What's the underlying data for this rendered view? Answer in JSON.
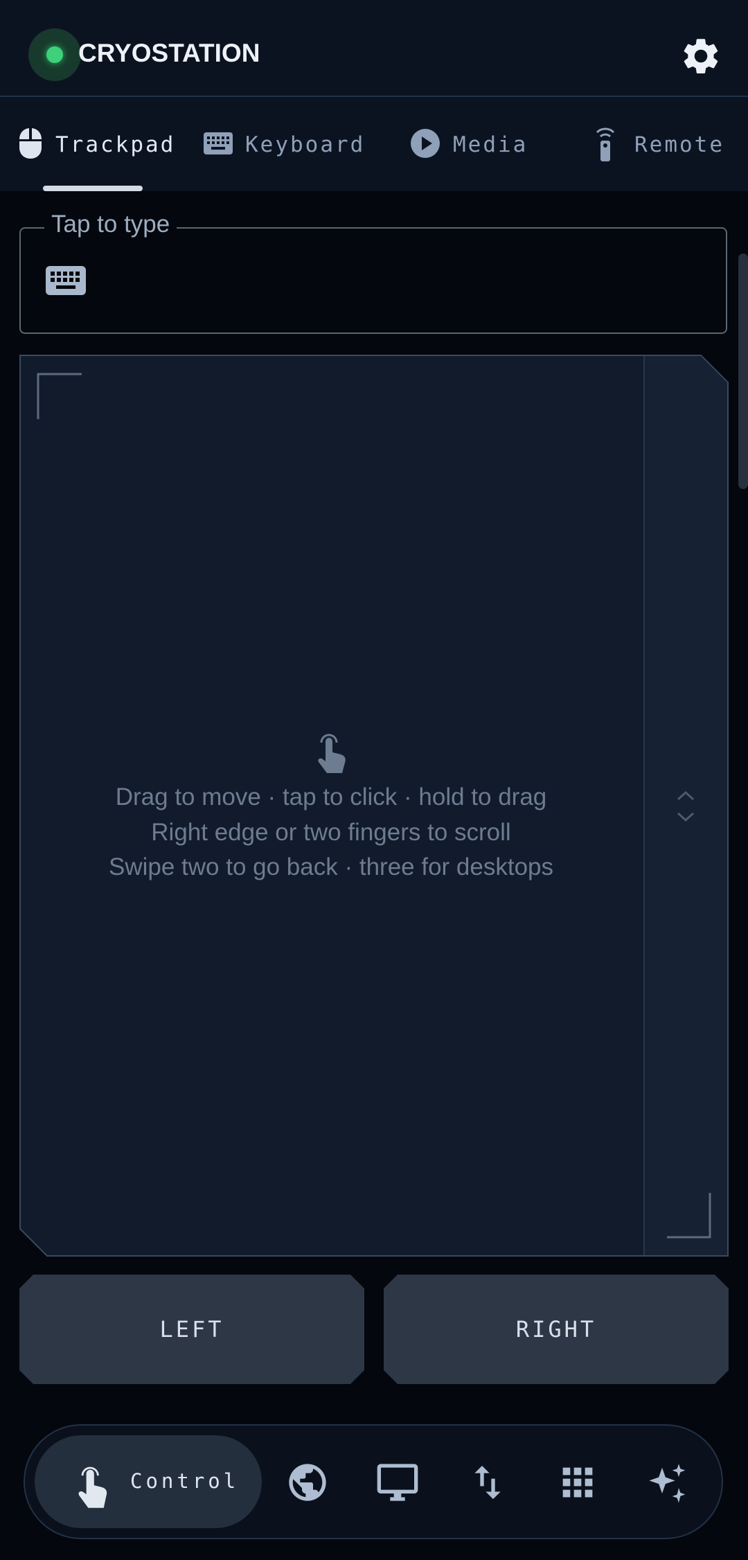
{
  "header": {
    "title": "CRYOSTATION",
    "status": "online",
    "status_color": "#3fd07b",
    "settings_icon": "gear-icon"
  },
  "tabs": [
    {
      "label": "Trackpad",
      "icon": "mouse-icon",
      "active": true
    },
    {
      "label": "Keyboard",
      "icon": "keyboard-icon",
      "active": false
    },
    {
      "label": "Media",
      "icon": "play-circle-icon",
      "active": false
    },
    {
      "label": "Remote",
      "icon": "remote-icon",
      "active": false
    }
  ],
  "type_field": {
    "label": "Tap to type",
    "value": "",
    "icon": "keyboard-icon"
  },
  "trackpad": {
    "hint_icon": "touch-icon",
    "hints": [
      "Drag to move · tap to click · hold to drag",
      "Right edge or two fingers to scroll",
      "Swipe two to go back · three for desktops"
    ],
    "scroll_zone_icon": "chevron-up-down-icon"
  },
  "buttons": {
    "left": "LEFT",
    "right": "RIGHT"
  },
  "bottom_nav": {
    "items": [
      {
        "label": "Control",
        "icon": "touch-icon",
        "active": true
      },
      {
        "label": "",
        "icon": "globe-icon",
        "active": false
      },
      {
        "label": "",
        "icon": "monitor-icon",
        "active": false
      },
      {
        "label": "",
        "icon": "transfer-arrows-icon",
        "active": false
      },
      {
        "label": "",
        "icon": "apps-grid-icon",
        "active": false
      },
      {
        "label": "",
        "icon": "sparkles-icon",
        "active": false
      }
    ]
  },
  "colors": {
    "background": "#04070d",
    "surface": "#0b1321",
    "trackpad": "#111b2c",
    "accent_text": "#e3e9f2",
    "muted_text": "#6d7c90"
  }
}
